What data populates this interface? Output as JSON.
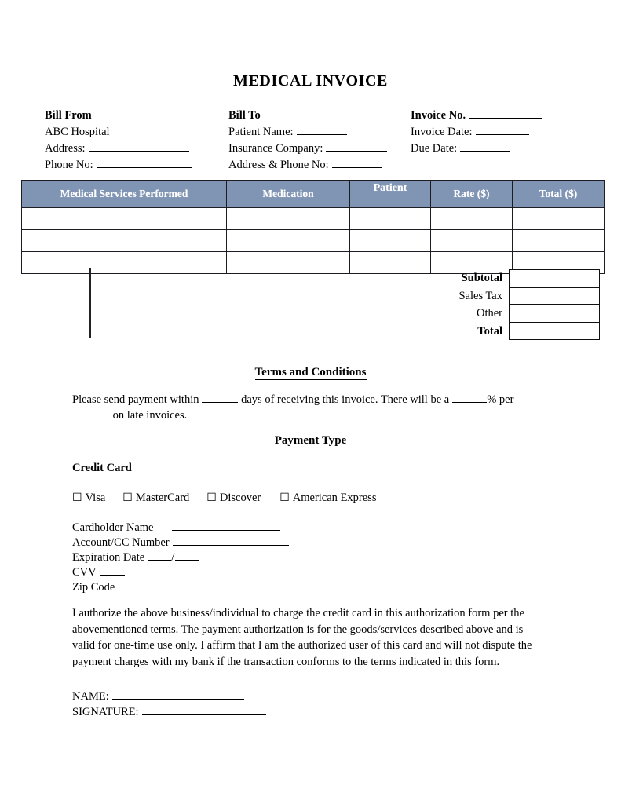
{
  "document": {
    "title": "MEDICAL INVOICE"
  },
  "bill_from": {
    "heading": "Bill From",
    "company": "ABC Hospital",
    "address_label": "Address:",
    "phone_label": "Phone No:"
  },
  "bill_to": {
    "heading": "Bill To",
    "patient_label": "Patient Name:",
    "insurance_label": "Insurance Company:",
    "address_phone_label": "Address & Phone No:"
  },
  "invoice_meta": {
    "invoice_no_label": "Invoice No.",
    "invoice_date_label": "Invoice Date:",
    "due_date_label": "Due Date:"
  },
  "table": {
    "headers": [
      "Medical Services Performed",
      "Medication",
      "Patient",
      "Rate ($)",
      "Total ($)"
    ],
    "rows": [
      [
        "",
        "",
        "",
        "",
        ""
      ],
      [
        "",
        "",
        "",
        "",
        ""
      ],
      [
        "",
        "",
        "",
        "",
        ""
      ]
    ],
    "header_bg": "#8094b4",
    "header_text_color": "#ffffff",
    "border_color": "#1c1c22"
  },
  "totals": [
    {
      "label": "Subtotal",
      "value": "",
      "bold": true
    },
    {
      "label": "Sales Tax",
      "value": "",
      "bold": false
    },
    {
      "label": "Other",
      "value": "",
      "bold": false
    },
    {
      "label": "Total",
      "value": "",
      "bold": true
    }
  ],
  "terms": {
    "heading": "Terms and Conditions",
    "text_part_1": "Please send payment within",
    "text_part_2": "days of receiving this invoice. There will be a",
    "text_part_3": "% per",
    "text_part_4": "on late invoices."
  },
  "payment": {
    "heading": "Payment Type",
    "credit_card_label": "Credit Card",
    "checkbox_glyph": "☐",
    "card_types": [
      "Visa",
      "MasterCard",
      "Discover",
      "American Express"
    ],
    "fields": [
      "Cardholder Name",
      "Account/CC Number",
      "Expiration Date",
      "CVV",
      "Zip Code"
    ],
    "expiration_separator": "/"
  },
  "authorization": {
    "text": "I authorize the above business/individual to charge the credit card in this authorization form per the abovementioned terms. The payment authorization is for the goods/services described above and is valid for one-time use only. I affirm that I am the authorized user of this card and will not dispute the payment charges with my bank if the transaction conforms to the terms indicated in this form."
  },
  "signature": {
    "name_label": "NAME:",
    "signature_label": "SIGNATURE:"
  }
}
